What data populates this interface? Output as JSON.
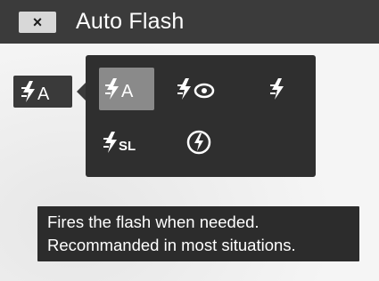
{
  "header": {
    "title": "Auto Flash",
    "close_symbol": "×",
    "close_icon": "close-icon"
  },
  "current_mode": {
    "icon": "flash-auto-icon",
    "letter": "A"
  },
  "flash_options": [
    {
      "icon": "flash-auto-icon",
      "letter": "A",
      "selected": true
    },
    {
      "icon": "flash-red-eye-icon",
      "selected": false
    },
    {
      "icon": "flash-on-icon",
      "selected": false
    },
    {
      "icon": "flash-slow-sync-icon",
      "letter": "SL",
      "selected": false
    },
    {
      "icon": "flash-off-icon",
      "selected": false
    }
  ],
  "tooltip": {
    "line1": "Fires the flash when needed.",
    "line2": "Recommanded in most situations."
  },
  "colors": {
    "topbar": "#3b3b3b",
    "panel": "#2f2f2f",
    "selected": "#8a8a8a",
    "icon": "#ffffff"
  }
}
